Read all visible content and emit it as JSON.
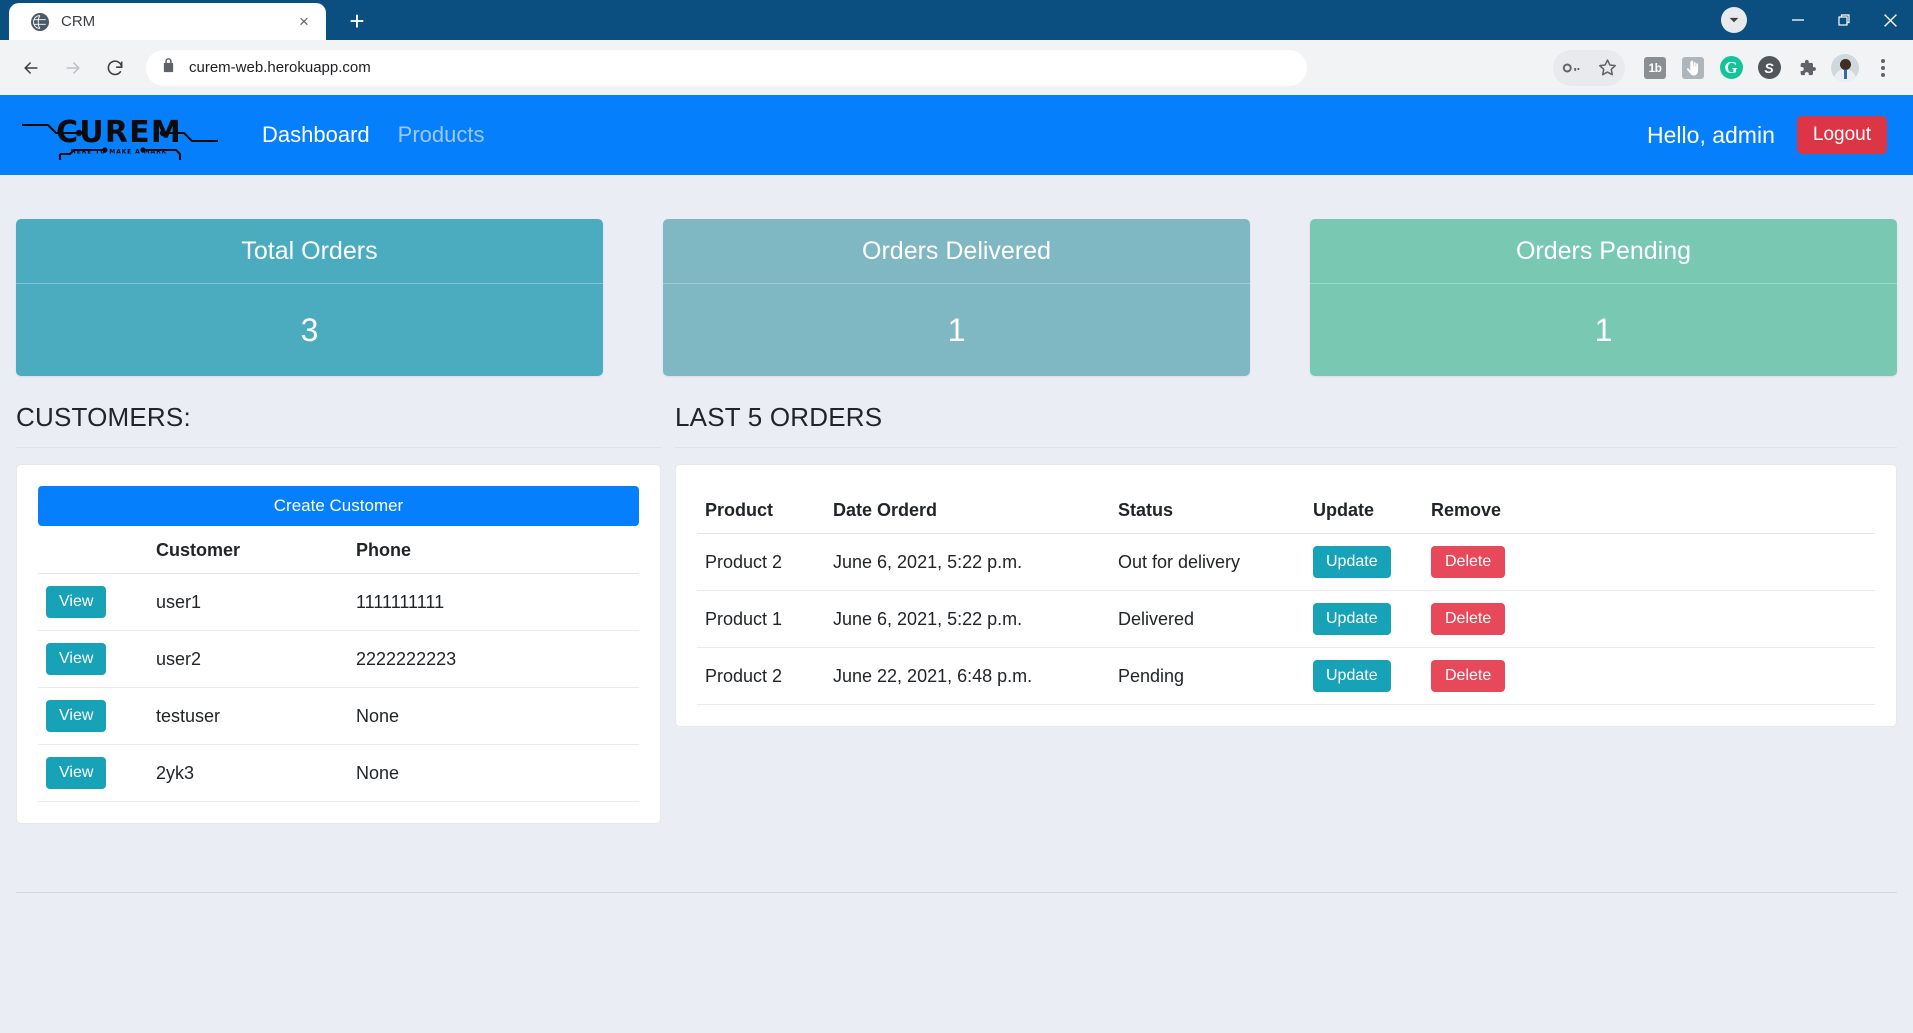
{
  "browser": {
    "tab": {
      "title": "CRM",
      "favicon": "globe-icon",
      "close": "×"
    },
    "newtab_label": "+",
    "window_controls": {
      "download": "download-badge",
      "minimize": "—",
      "maximize": "❐",
      "close": "✕"
    },
    "nav": {
      "back": "←",
      "forward": "→",
      "reload": "⟳"
    },
    "omnibox": {
      "url": "curem-web.herokuapp.com",
      "lock": "lock-icon"
    },
    "toolbar_icons": [
      {
        "name": "password-key-icon",
        "glyph": "⎇"
      },
      {
        "name": "bookmark-star-icon",
        "glyph": "☆"
      },
      {
        "name": "extension-1b-icon",
        "glyph": "1b"
      },
      {
        "name": "extension-hand-cursor-icon",
        "glyph": "☚"
      },
      {
        "name": "grammarly-icon",
        "glyph": "G"
      },
      {
        "name": "skype-icon",
        "glyph": "S"
      },
      {
        "name": "extensions-puzzle-icon",
        "glyph": "❖"
      },
      {
        "name": "profile-avatar-icon",
        "glyph": ""
      },
      {
        "name": "chrome-menu-icon",
        "glyph": "⋮"
      }
    ]
  },
  "site": {
    "logo": {
      "word": "CUREM",
      "tagline": "HERE TO MAKE A MARK"
    },
    "nav_links": [
      {
        "label": "Dashboard",
        "active": true
      },
      {
        "label": "Products",
        "active": false
      }
    ],
    "greeting": "Hello, admin",
    "logout_label": "Logout",
    "colors": {
      "navbar": "#067ffc",
      "logout": "#dc3545",
      "primary_button": "#057ffc",
      "view_button": "#17a2b8",
      "delete_button": "#e8495a",
      "page_background": "#eaedf4"
    }
  },
  "stats": [
    {
      "title": "Total Orders",
      "value": "3",
      "color": "#4bacc0",
      "name": "total-orders"
    },
    {
      "title": "Orders Delivered",
      "value": "1",
      "color": "#7fb8c2",
      "name": "orders-delivered"
    },
    {
      "title": "Orders Pending",
      "value": "1",
      "color": "#79c9b2",
      "name": "orders-pending"
    }
  ],
  "customers_section": {
    "heading": "CUSTOMERS:",
    "create_button": "Create Customer",
    "columns": [
      "",
      "Customer",
      "Phone"
    ],
    "rows": [
      {
        "action": "View",
        "customer": "user1",
        "phone": "1111111111"
      },
      {
        "action": "View",
        "customer": "user2",
        "phone": "2222222223"
      },
      {
        "action": "View",
        "customer": "testuser",
        "phone": "None"
      },
      {
        "action": "View",
        "customer": "2yk3",
        "phone": "None"
      }
    ]
  },
  "orders_section": {
    "heading": "LAST 5 ORDERS",
    "columns": [
      "Product",
      "Date Orderd",
      "Status",
      "Update",
      "Remove"
    ],
    "rows": [
      {
        "product": "Product 2",
        "date": "June 6, 2021, 5:22 p.m.",
        "status": "Out for delivery",
        "update": "Update",
        "remove": "Delete"
      },
      {
        "product": "Product 1",
        "date": "June 6, 2021, 5:22 p.m.",
        "status": "Delivered",
        "update": "Update",
        "remove": "Delete"
      },
      {
        "product": "Product 2",
        "date": "June 22, 2021, 6:48 p.m.",
        "status": "Pending",
        "update": "Update",
        "remove": "Delete"
      }
    ]
  }
}
